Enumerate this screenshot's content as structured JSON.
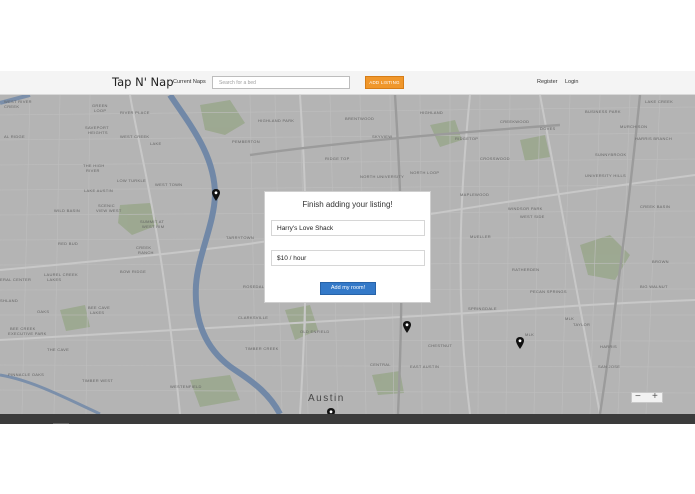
{
  "navbar": {
    "brand": "Tap N' Nap",
    "current_naps": "Current Naps",
    "search_placeholder": "Search for a bed",
    "add_listing": "ADD LISTING",
    "register": "Register",
    "login": "Login"
  },
  "map": {
    "city_label": "Austin",
    "zoom_out": "−",
    "zoom_in": "+",
    "labels": [
      "WEST RIVER",
      "CREEK",
      "SAVEPORT",
      "HEIGHTS",
      "RIVER PLACE",
      "GREEN",
      "LOOP",
      "AL RIDGE",
      "WEST CREEK",
      "LAKE",
      "THE HIGH",
      "RIVER",
      "LOW TURKLE",
      "WEST TOWN",
      "LAKE AUSTIN",
      "WILD BASIN",
      "SCENIC",
      "VIEW WEST",
      "SUMMIT AT",
      "WEST RIM",
      "RED BUD",
      "ERAL CENTER",
      "CREEK",
      "RANCH",
      "LAUREL CREEK",
      "LAKES",
      "BOW RIDGE",
      "SHLAND",
      "TARRYTOWN",
      "OAKS",
      "BEE CREEK",
      "EXECUTIVE PARK",
      "BEE CAVE",
      "LAKES",
      "THE CAVE",
      "PINNACLE OAKS",
      "TIMBER WEST",
      "ROSEDALE",
      "PEMBERTON",
      "WESTENFIELD",
      "BRENTWOOD",
      "HIGHLAND",
      "HIGHLAND PARK",
      "RIDGE TOP",
      "NORTH LOOP",
      "NORTH UNIVERSITY",
      "MAPLEWOOD",
      "WINDSOR PARK",
      "UNIVERSITY HILLS",
      "MUELLER",
      "RATHERDEN",
      "CHESTNUT",
      "EAST AUSTIN",
      "CENTRAL",
      "CLARKSVILLE",
      "TAYLOR",
      "SAN JOSE",
      "MLK",
      "MLK",
      "BROWN",
      "LAKE CREEK",
      "BUSINESS PARK",
      "MURCHISON",
      "DOVES",
      "CREEKWOOD",
      "CROSSWOOD",
      "SUNNYBROOK",
      "HARRIS BRANCH",
      "CREEK BASIN",
      "PECAN SPRINGS",
      "SPRINGDALE",
      "SKYVIEW",
      "RIDGETOP",
      "WEST SIDE",
      "BIG WALNUT",
      "OLD ENFIELD",
      "TIMBER CREEK",
      "HARRIS"
    ]
  },
  "modal": {
    "title": "Finish adding your listing!",
    "name_value": "Harry's Love Shack",
    "price_value": "$10 / hour",
    "submit": "Add my room!"
  },
  "colors": {
    "add_listing_bg": "#f0972b",
    "submit_bg": "#3479c8",
    "river": "#7f9fc9",
    "park": "#b6c9a4"
  },
  "icons": [
    "map-pin-icon"
  ]
}
